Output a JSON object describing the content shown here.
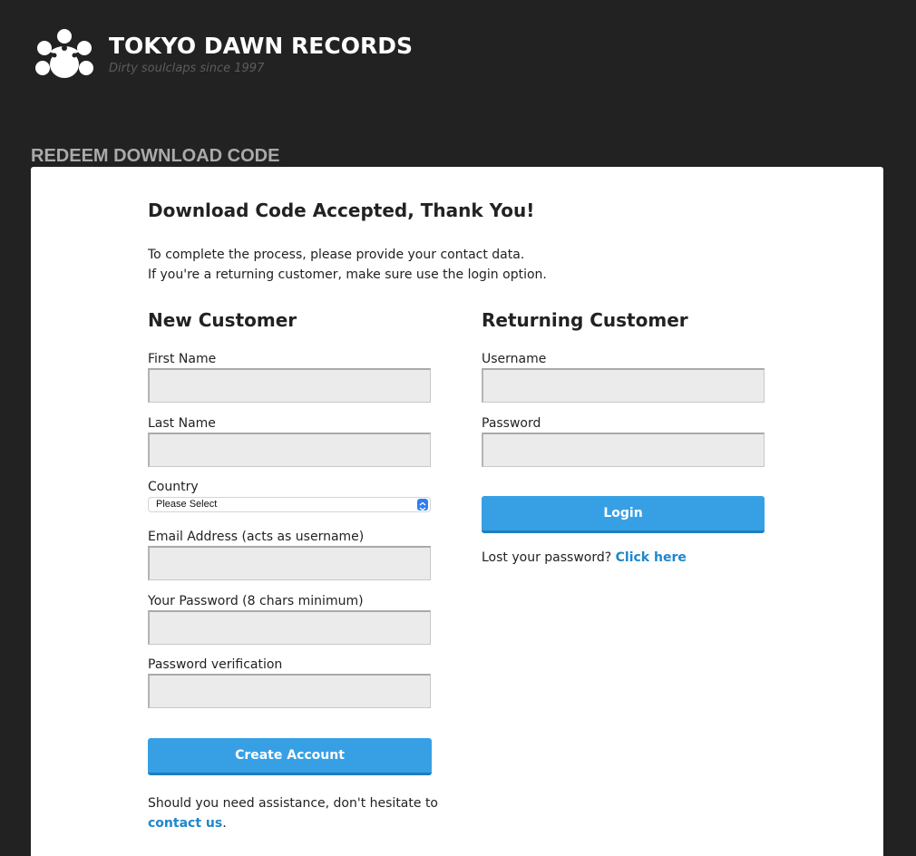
{
  "header": {
    "brand_name": "TOKYO DAWN RECORDS",
    "tagline": "Dirty soulclaps since 1997",
    "logo_icon": "flower-paw-logo-icon"
  },
  "section": {
    "heading": "REDEEM DOWNLOAD CODE"
  },
  "panel": {
    "title": "Download Code Accepted, Thank You!",
    "intro_line1": "To complete the process, please provide your contact data.",
    "intro_line2": "If you're a returning customer, make sure use the login option."
  },
  "new_customer": {
    "heading": "New Customer",
    "first_name_label": "First Name",
    "first_name_value": "",
    "last_name_label": "Last Name",
    "last_name_value": "",
    "country_label": "Country",
    "country_selected": "Please Select",
    "email_label": "Email Address (acts as username)",
    "email_value": "",
    "password_label": "Your Password (8 chars minimum)",
    "password_value": "",
    "password_verify_label": "Password verification",
    "password_verify_value": "",
    "create_button": "Create Account",
    "assist_text": "Should you need assistance, don't hesitate to",
    "contact_link": "contact us",
    "assist_period": "."
  },
  "returning_customer": {
    "heading": "Returning Customer",
    "username_label": "Username",
    "username_value": "",
    "password_label": "Password",
    "password_value": "",
    "login_button": "Login",
    "lost_password_text": "Lost your password?",
    "click_here_link": "Click here"
  },
  "colors": {
    "page_background": "#222222",
    "panel_background": "#ffffff",
    "button": "#37a0e5",
    "link": "#1e87cc",
    "input_background": "#ebebeb"
  }
}
